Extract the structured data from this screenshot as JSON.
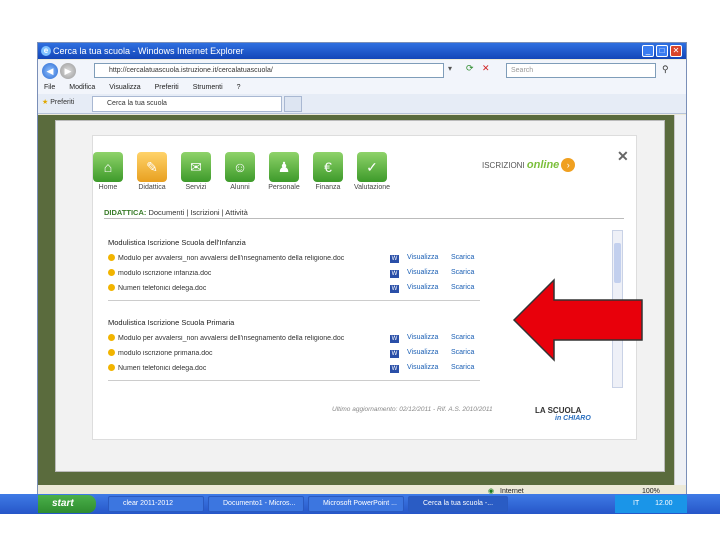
{
  "window": {
    "title": "Cerca la tua scuola - Windows Internet Explorer",
    "address": "http://cercalatuascuola.istruzione.it/cercalatuascuola/",
    "search_placeholder": "Search",
    "tab_title": "Cerca la tua scuola",
    "favorites_label": "Preferiti"
  },
  "menu": [
    "File",
    "Modifica",
    "Visualizza",
    "Preferiti",
    "Strumenti",
    "?"
  ],
  "status": {
    "zone": "Internet",
    "zoom": "100%"
  },
  "nav": [
    {
      "label": "Home",
      "icon": "home-icon",
      "glyph": "⌂"
    },
    {
      "label": "Didattica",
      "icon": "didattica-icon",
      "glyph": "✎"
    },
    {
      "label": "Servizi",
      "icon": "servizi-icon",
      "glyph": "✉"
    },
    {
      "label": "Alunni",
      "icon": "alunni-icon",
      "glyph": "☺"
    },
    {
      "label": "Personale",
      "icon": "personale-icon",
      "glyph": "♟"
    },
    {
      "label": "Finanza",
      "icon": "finanza-icon",
      "glyph": "€"
    },
    {
      "label": "Valutazione",
      "icon": "valutazione-icon",
      "glyph": "✓"
    }
  ],
  "iscrizioni": {
    "prefix": "ISCRIZIONI",
    "suffix": "online"
  },
  "breadcrumb": {
    "section": "DIDATTICA:",
    "items": "Documenti | Iscrizioni | Attività"
  },
  "sections": [
    {
      "title": "Modulistica Iscrizione Scuola dell'Infanzia",
      "rows": [
        {
          "name": "Modulo per avvalersi_non avvalersi dell'insegnamento della religione.doc",
          "view": "Visualizza",
          "download": "Scarica"
        },
        {
          "name": "modulo iscrizione infanzia.doc",
          "view": "Visualizza",
          "download": "Scarica"
        },
        {
          "name": "Numeri telefonici delega.doc",
          "view": "Visualizza",
          "download": "Scarica"
        }
      ]
    },
    {
      "title": "Modulistica Iscrizione Scuola Primaria",
      "rows": [
        {
          "name": "Modulo per avvalersi_non avvalersi dell'insegnamento della religione.doc",
          "view": "Visualizza",
          "download": "Scarica"
        },
        {
          "name": "modulo iscrizione primaria.doc",
          "view": "Visualizza",
          "download": "Scarica"
        },
        {
          "name": "Numeri telefonici delega.doc",
          "view": "Visualizza",
          "download": "Scarica"
        }
      ]
    }
  ],
  "footer": "Ultimo aggiornamento: 02/12/2011 - Rif. A.S. 2010/2011",
  "logo": {
    "line1": "LA SCUOLA",
    "line2": "in CHIARO"
  },
  "taskbar": {
    "start": "start",
    "tasks": [
      "clear 2011-2012",
      "Documento1 - Micros...",
      "Microsoft PowerPoint ...",
      "Cerca la tua scuola -..."
    ],
    "clock": "12.00",
    "lang": "IT"
  },
  "colors": {
    "arrow": "#e8000b",
    "accent_green": "#7bbf3a",
    "link_blue": "#1a5fb4"
  }
}
